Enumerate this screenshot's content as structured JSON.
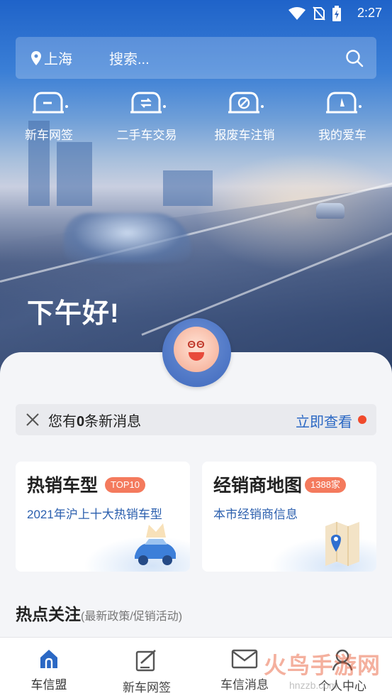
{
  "status_bar": {
    "time": "2:27"
  },
  "search": {
    "location": "上海",
    "placeholder": "搜索..."
  },
  "quick_nav": [
    {
      "label": "新车网签",
      "icon": "new-car-icon"
    },
    {
      "label": "二手车交易",
      "icon": "used-car-icon"
    },
    {
      "label": "报废车注销",
      "icon": "scrap-car-icon"
    },
    {
      "label": "我的爱车",
      "icon": "my-car-icon"
    }
  ],
  "greeting": "下午好!",
  "notice": {
    "prefix": "您有",
    "count": "0",
    "suffix": "条新消息",
    "action": "立即查看"
  },
  "cards": [
    {
      "title": "热销车型",
      "badge": "TOP10",
      "subtitle": "2021年沪上十大热销车型"
    },
    {
      "title": "经销商地图",
      "badge": "1388家",
      "subtitle": "本市经销商信息"
    }
  ],
  "section": {
    "title": "热点关注",
    "hint": "(最新政策/促销活动)"
  },
  "tabbar": [
    {
      "label": "车信盟",
      "icon": "home-icon",
      "active": true
    },
    {
      "label": "新车网签",
      "icon": "sign-icon",
      "active": false
    },
    {
      "label": "车信消息",
      "icon": "mail-icon",
      "active": false
    },
    {
      "label": "个人中心",
      "icon": "person-icon",
      "active": false
    }
  ],
  "watermark": {
    "text": "火鸟手游网",
    "url": "hnzzb.com"
  },
  "colors": {
    "primary": "#2b68c4",
    "badge": "#f47a5d",
    "alert_dot": "#f04a2c"
  }
}
